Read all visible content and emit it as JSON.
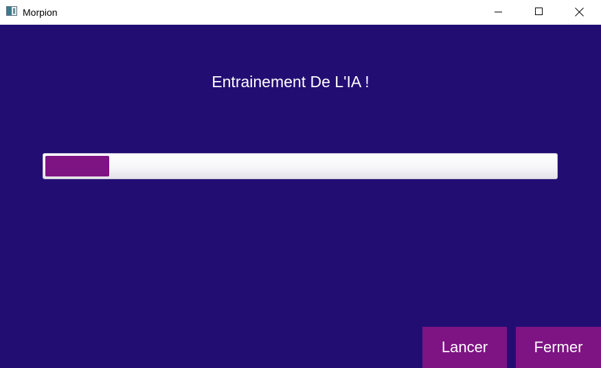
{
  "window": {
    "title": "Morpion",
    "icon": "app-window-icon",
    "controls": [
      "minimize-icon",
      "maximize-icon",
      "close-icon"
    ]
  },
  "main": {
    "heading": "Entrainement De L'IA !",
    "progress_percent": 12.5,
    "buttons": {
      "launch": "Lancer",
      "close": "Fermer"
    }
  },
  "colors": {
    "background": "#220e73",
    "accent": "#7e1384",
    "text": "#ffffff"
  }
}
